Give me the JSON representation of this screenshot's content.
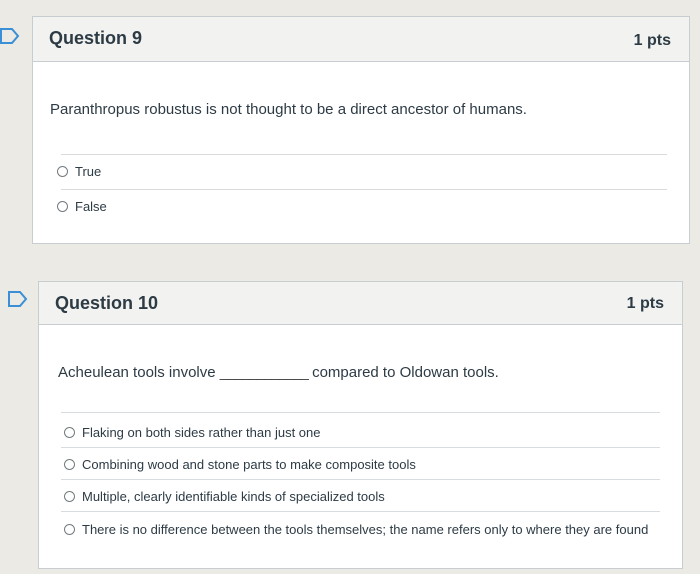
{
  "question9": {
    "title": "Question 9",
    "points": "1 pts",
    "text": "Paranthropus robustus is not thought to be a direct ancestor of humans.",
    "answers": [
      "True",
      "False"
    ]
  },
  "question10": {
    "title": "Question 10",
    "points": "1 pts",
    "text_before": "Acheulean tools involve",
    "blank": "____________",
    "text_after": "compared to Oldowan tools.",
    "answers": [
      "Flaking on both sides rather than just one",
      "Combining wood and stone parts to make composite tools",
      "Multiple, clearly identifiable kinds of specialized tools",
      "There is no difference between the tools themselves; the name refers only to where they are found"
    ]
  },
  "colors": {
    "bookmark": "#3b8fd6",
    "header_bg": "#f2f2f0",
    "border": "#c7cdd1",
    "text": "#2d3b45"
  },
  "icons": [
    "bookmark-flag-icon",
    "radio-button-icon"
  ]
}
